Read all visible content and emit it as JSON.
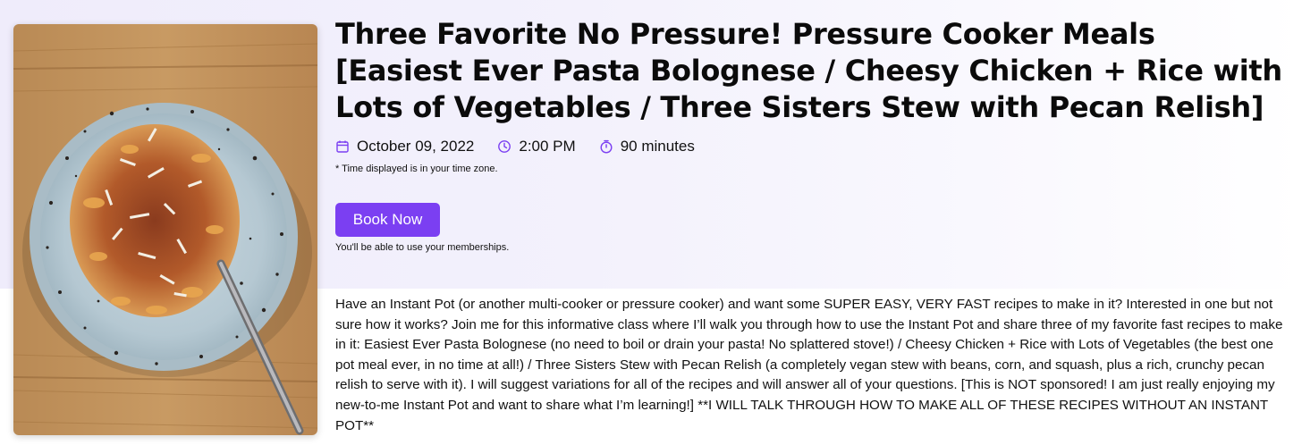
{
  "event": {
    "title": "Three Favorite No Pressure! Pressure Cooker Meals [Easiest Ever Pasta Bolognese / Cheesy Chicken + Rice with Lots of Vegetables / Three Sisters Stew with Pecan Relish]",
    "date": "October 09, 2022",
    "time": "2:00 PM",
    "duration": "90 minutes",
    "timezone_note": "* Time displayed is in your time zone.",
    "book_button_label": "Book Now",
    "membership_note": "You'll be able to use your memberships.",
    "description": "Have an Instant Pot (or another multi-cooker or pressure cooker) and want some SUPER EASY, VERY FAST recipes to make in it? Interested in one but not sure how it works? Join me for this informative class where I’ll walk you through how to use the Instant Pot and share three of my favorite fast recipes to make in it: Easiest Ever Pasta Bolognese (no need to boil or drain your pasta! No splattered stove!) / Cheesy Chicken + Rice with Lots of Vegetables (the best one pot meal ever, in no time at all!) / Three Sisters Stew with Pecan Relish (a completely vegan stew with beans, corn, and squash, plus a rich, crunchy pecan relish to serve with it). I will suggest variations for all of the recipes and will answer all of your questions. [This is NOT sponsored! I am just really enjoying my new-to-me Instant Pot and want to share what I’m learning!] **I WILL TALK THROUGH HOW TO MAKE ALL OF THESE RECIPES WITHOUT AN INSTANT POT**"
  },
  "icons": {
    "date": "calendar-icon",
    "time": "clock-icon",
    "duration": "stopwatch-icon"
  },
  "colors": {
    "accent": "#7b3ff2",
    "icon": "#7b3ff2",
    "hero_background": "#efecfb"
  }
}
